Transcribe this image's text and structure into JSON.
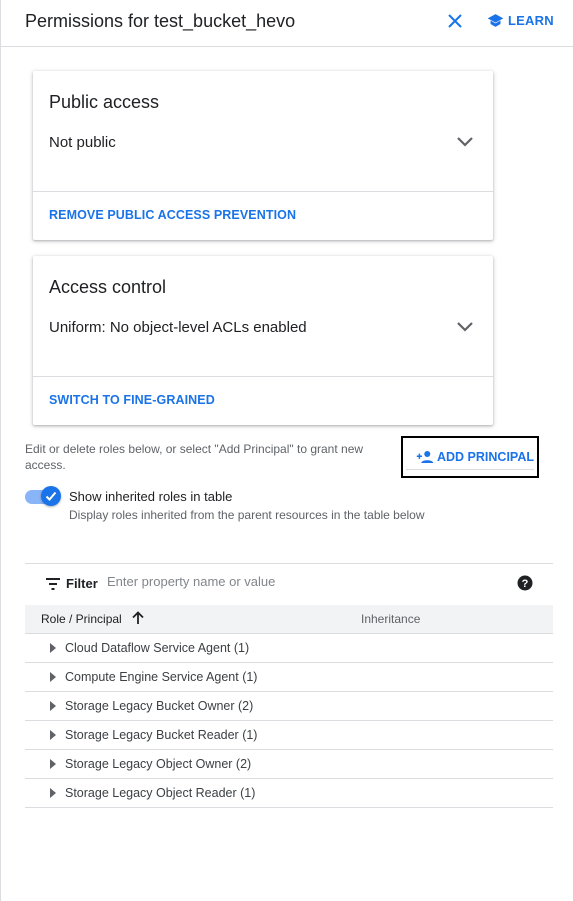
{
  "header": {
    "title": "Permissions for test_bucket_hevo",
    "learn_label": "LEARN"
  },
  "public_access": {
    "title": "Public access",
    "value": "Not public",
    "action": "REMOVE PUBLIC ACCESS PREVENTION"
  },
  "access_control": {
    "title": "Access control",
    "value": "Uniform: No object-level ACLs enabled",
    "action": "SWITCH TO FINE-GRAINED"
  },
  "principals": {
    "help_text": "Edit or delete roles below, or select \"Add Principal\" to grant new access.",
    "add_label": "ADD PRINCIPAL"
  },
  "inherited_toggle": {
    "checked": true,
    "label": "Show inherited roles in table",
    "sublabel": "Display roles inherited from the parent resources in the table below"
  },
  "filter": {
    "label": "Filter",
    "placeholder": "Enter property name or value"
  },
  "table": {
    "columns": [
      "Role / Principal",
      "Inheritance"
    ],
    "rows": [
      "Cloud Dataflow Service Agent (1)",
      "Compute Engine Service Agent (1)",
      "Storage Legacy Bucket Owner (2)",
      "Storage Legacy Bucket Reader (1)",
      "Storage Legacy Object Owner (2)",
      "Storage Legacy Object Reader (1)"
    ]
  },
  "colors": {
    "accent": "#1a73e8",
    "text": "#202124",
    "muted": "#5f6368",
    "divider": "#dadce0"
  }
}
